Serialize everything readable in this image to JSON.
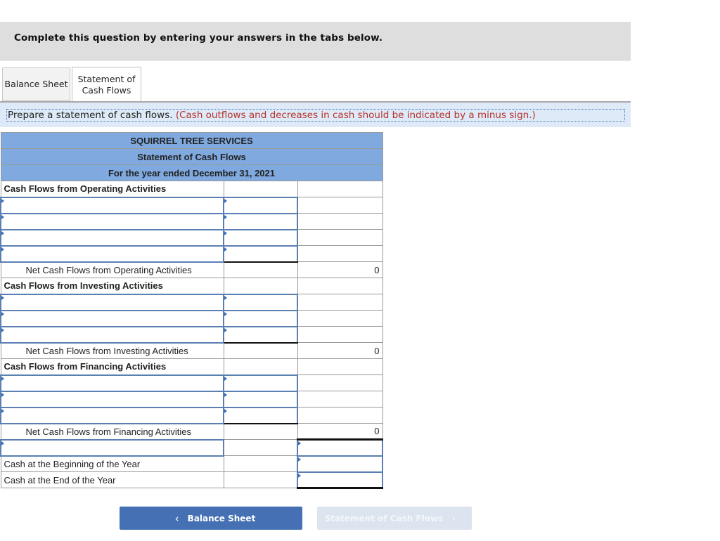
{
  "banner": {
    "text": "Complete this question by entering your answers in the tabs below."
  },
  "tabs": [
    {
      "label": "Balance Sheet",
      "active": false
    },
    {
      "label": "Statement of Cash Flows",
      "line1": "Statement of",
      "line2": "Cash Flows",
      "active": true
    }
  ],
  "instruction": {
    "text": "Prepare a statement of cash flows.",
    "note": "(Cash outflows and decreases in cash should be indicated by a minus sign.)"
  },
  "statement": {
    "company": "SQUIRREL TREE SERVICES",
    "title": "Statement of Cash Flows",
    "period": "For the year ended December 31, 2021",
    "operating": {
      "heading": "Cash Flows from Operating Activities",
      "input_rows": 4,
      "net_label": "Net Cash Flows from Operating Activities",
      "net_value": "0"
    },
    "investing": {
      "heading": "Cash Flows from Investing Activities",
      "input_rows": 3,
      "net_label": "Net Cash Flows from Investing Activities",
      "net_value": "0"
    },
    "financing": {
      "heading": "Cash Flows from Financing Activities",
      "input_rows": 3,
      "net_label": "Net Cash Flows from Financing Activities",
      "net_value": "0"
    },
    "cash_beginning_label": "Cash at the Beginning of the Year",
    "cash_end_label": "Cash at the End of the Year"
  },
  "nav": {
    "prev_label": "Balance Sheet",
    "prev_icon": "chevron-left-icon",
    "next_label": "Statement of Cash Flows",
    "next_icon": "chevron-right-icon",
    "next_disabled": true
  }
}
